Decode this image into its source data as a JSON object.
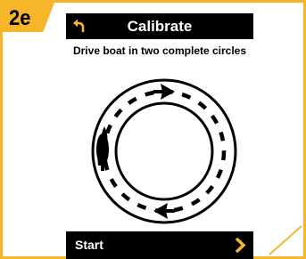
{
  "step_badge": "2e",
  "header": {
    "title": "Calibrate",
    "back_icon": "back-arrow-icon"
  },
  "instruction": "Drive boat in two complete circles",
  "diagram": {
    "boat_icon": "boat-icon",
    "arrow_icons": [
      "arrow-right-icon",
      "arrow-left-icon"
    ]
  },
  "footer": {
    "start_label": "Start",
    "next_icon": "chevron-right-icon"
  },
  "colors": {
    "accent": "#f5b62a",
    "bar": "#000000",
    "text_on_bar": "#ffffff"
  }
}
